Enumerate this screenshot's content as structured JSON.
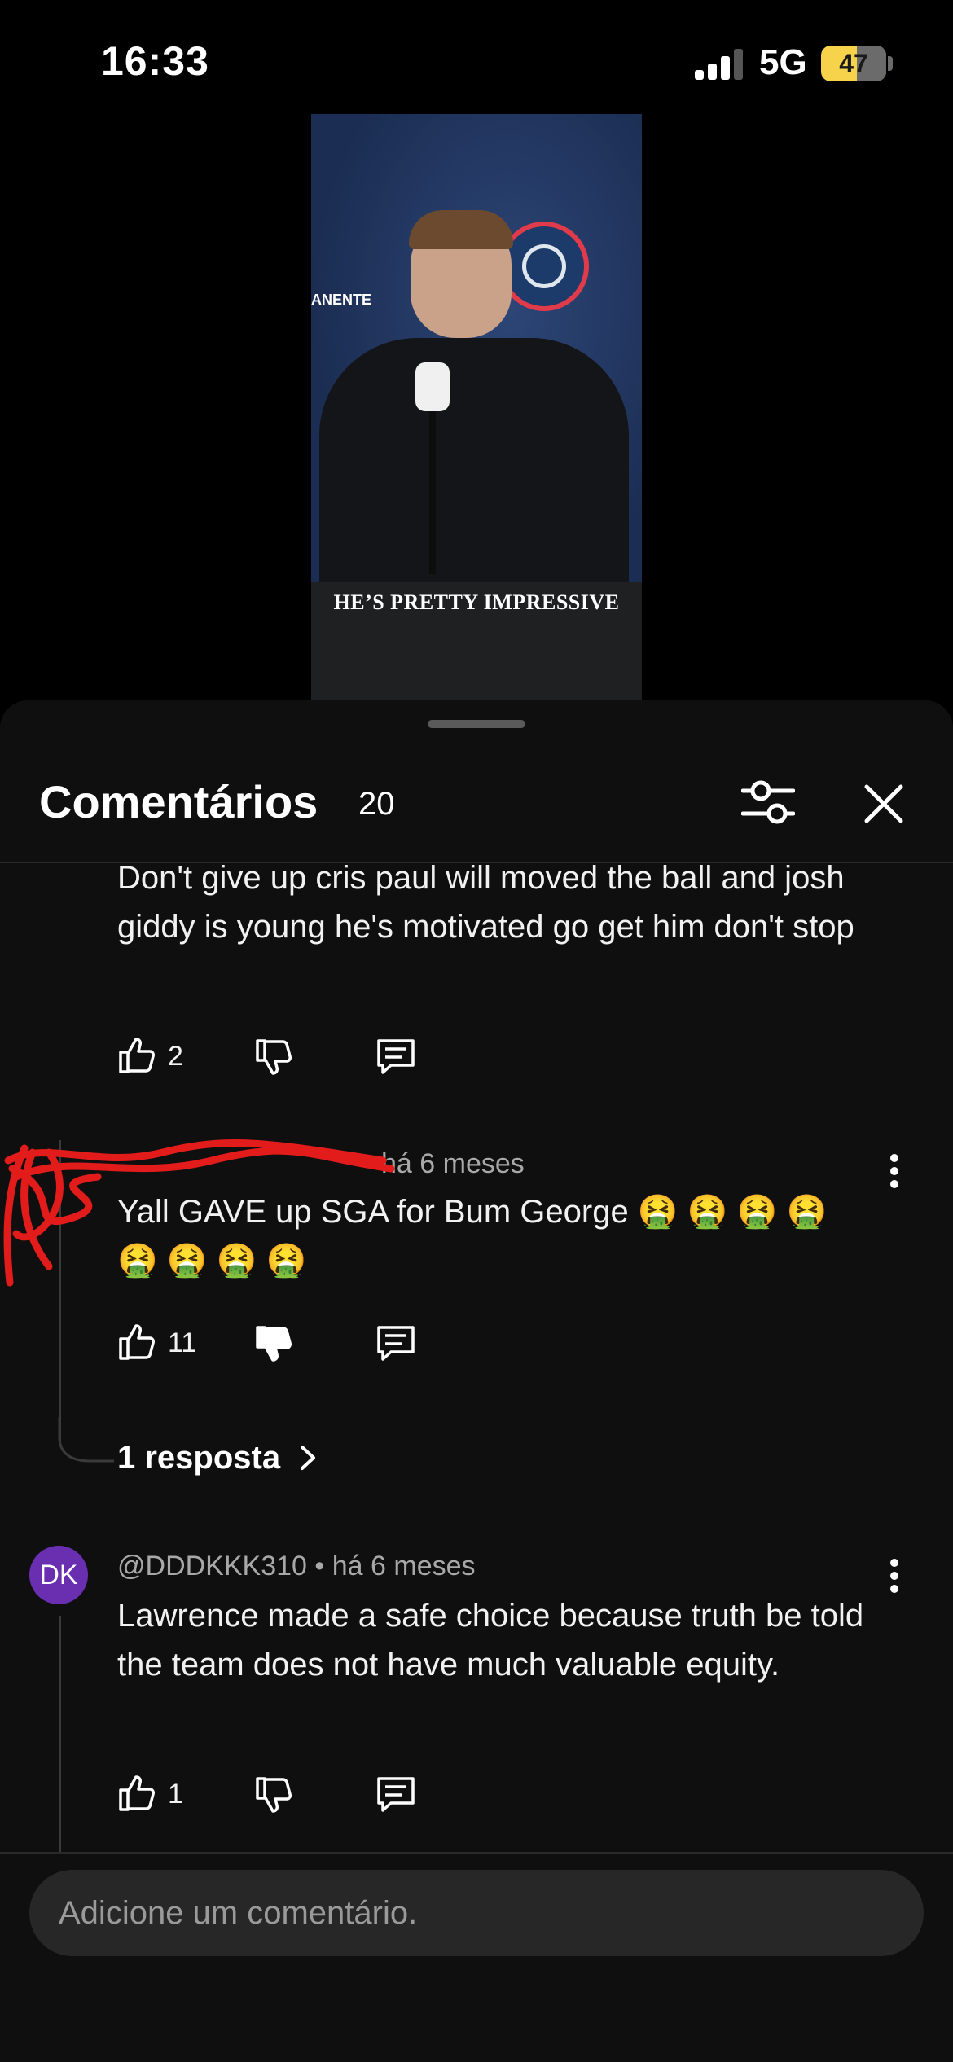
{
  "status_bar": {
    "time": "16:33",
    "network": "5G",
    "battery": "47"
  },
  "video": {
    "caption": "HE’S PRETTY IMPRESSIVE",
    "sponsor_text": "ANENTE"
  },
  "sheet": {
    "title": "Comentários",
    "count": "20",
    "add_comment_placeholder": "Adicione um comentário."
  },
  "comments": [
    {
      "text": "Don't give up cris paul will moved the ball and josh giddy is young he's motivated go get him don't stop",
      "likes": "2"
    },
    {
      "time": "há 6 meses",
      "text_line1": "Yall GAVE up SGA for Bum George 🤮 🤮 🤮 🤮",
      "text_line2": "🤮 🤮 🤮 🤮",
      "likes": "11",
      "replies": "1 resposta"
    },
    {
      "avatar": "DK",
      "author": "@DDDKKK310",
      "time": "há 6 meses",
      "text": "Lawrence made a safe choice because truth be told the team does not have much valuable equity.",
      "likes": "1"
    }
  ],
  "icons": {
    "like": "thumbs-up-icon",
    "dislike": "thumbs-down-icon",
    "reply": "reply-icon",
    "more": "more-vertical-icon",
    "filter": "filter-icon",
    "close": "close-icon"
  },
  "colors": {
    "avatar_dk": "#6a2fb0",
    "battery": "#f6d34a",
    "scribble": "#e21b1b"
  }
}
